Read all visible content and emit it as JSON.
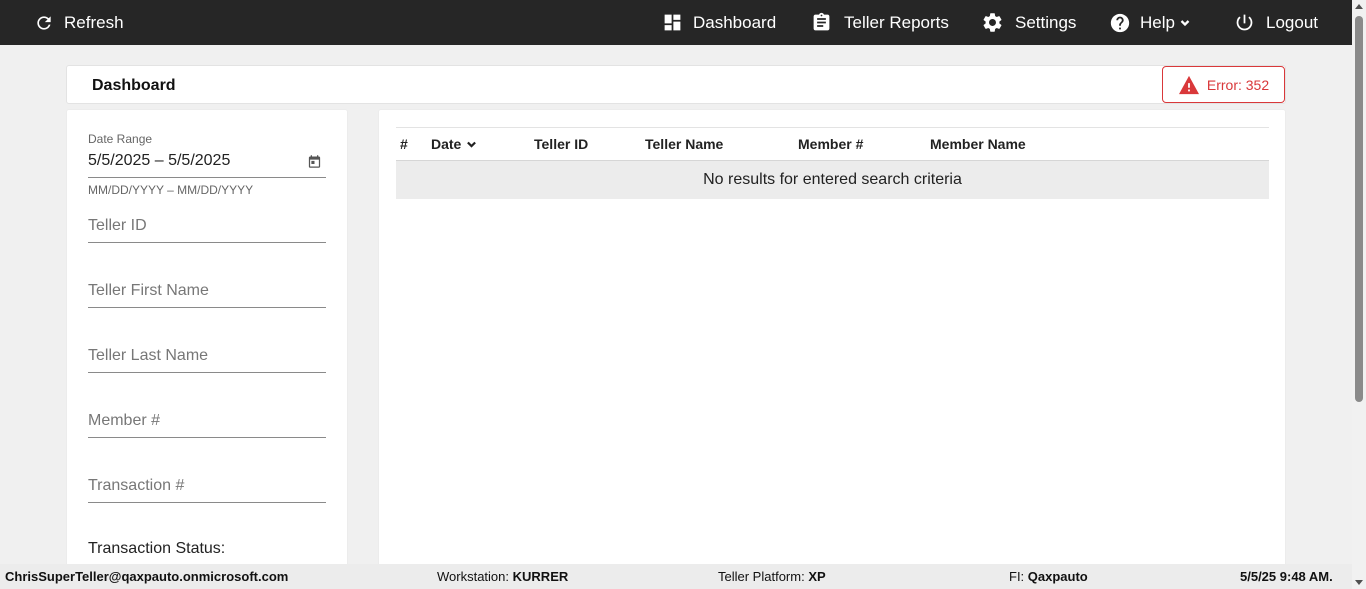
{
  "nav": {
    "refresh": "Refresh",
    "dashboard": "Dashboard",
    "teller_reports": "Teller Reports",
    "settings": "Settings",
    "help": "Help",
    "logout": "Logout",
    "bg_color": "#262626"
  },
  "header": {
    "title": "Dashboard",
    "error_label": "Error: 352",
    "error_color": "#d9383a"
  },
  "filters": {
    "date_range_label": "Date Range",
    "date_range_value": "5/5/2025 – 5/5/2025",
    "date_hint": "MM/DD/YYYY – MM/DD/YYYY",
    "teller_id": "Teller ID",
    "teller_first_name": "Teller First Name",
    "teller_last_name": "Teller Last Name",
    "member_number": "Member #",
    "transaction_number": "Transaction #",
    "transaction_status": "Transaction Status:"
  },
  "table": {
    "columns": [
      "#",
      "Date",
      "Teller ID",
      "Teller Name",
      "Member #",
      "Member Name"
    ],
    "empty_message": "No results for entered search criteria"
  },
  "footer": {
    "user": "ChrisSuperTeller@qaxpauto.onmicrosoft.com",
    "workstation_label": "Workstation:",
    "workstation_value": "KURRER",
    "platform_label": "Teller Platform:",
    "platform_value": "XP",
    "fi_label": "FI:",
    "fi_value": "Qaxpauto",
    "datetime": "5/5/25 9:48 AM."
  }
}
